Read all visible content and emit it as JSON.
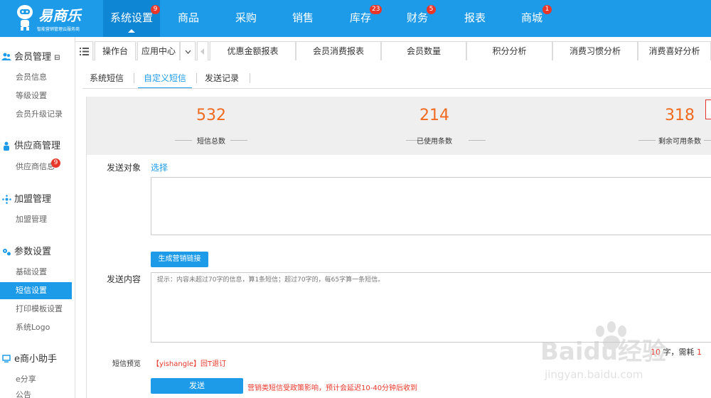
{
  "brand": {
    "name": "易商乐",
    "tagline": "智能营销管理云服务商"
  },
  "nav": [
    {
      "label": "系统设置",
      "badge": "9",
      "active": true
    },
    {
      "label": "商品",
      "badge": ""
    },
    {
      "label": "采购",
      "badge": ""
    },
    {
      "label": "销售",
      "badge": ""
    },
    {
      "label": "库存",
      "badge": "23"
    },
    {
      "label": "财务",
      "badge": "5"
    },
    {
      "label": "报表",
      "badge": ""
    },
    {
      "label": "商城",
      "badge": "1"
    }
  ],
  "sidebar": {
    "sections": [
      {
        "title": "会员管理",
        "toggle": "⊟",
        "icon": "users-icon",
        "items": [
          "会员信息",
          "等级设置",
          "会员升级记录"
        ]
      },
      {
        "title": "供应商管理",
        "icon": "supplier-icon",
        "items": [
          "供应商信息"
        ],
        "item_badge": "9"
      },
      {
        "title": "加盟管理",
        "icon": "network-icon",
        "items": [
          "加盟管理"
        ]
      },
      {
        "title": "参数设置",
        "icon": "gears-icon",
        "items": [
          "基础设置",
          "短信设置",
          "打印模板设置",
          "系统Logo"
        ],
        "active_item": "短信设置"
      },
      {
        "title": "e商小助手",
        "icon": "monitor-icon",
        "items": [
          "e分享",
          "公告"
        ]
      }
    ]
  },
  "tabs": {
    "home": "操作台",
    "app_center": "应用中心",
    "list": [
      "优惠金额报表",
      "会员消费报表",
      "会员数量",
      "积分分析",
      "消费习惯分析",
      "消费喜好分析"
    ]
  },
  "subtabs": [
    "系统短信",
    "自定义短信",
    "发送记录"
  ],
  "subtab_active": "自定义短信",
  "stats": [
    {
      "value": "532",
      "label": "短信总数"
    },
    {
      "value": "214",
      "label": "已使用条数"
    },
    {
      "value": "318",
      "label": "剩余可用条数"
    }
  ],
  "form": {
    "recipient_label": "发送对象",
    "select_link": "选择",
    "gen_link_button": "生成营销链接",
    "content_label": "发送内容",
    "content_hint": "提示：内容未超过70字的信息，算1条短信；超过70字的，每65字算一条短信。",
    "count_prefix": "",
    "count_value": "10",
    "count_suffix": "字，需耗",
    "count_tail": "1",
    "preview_label": "短信预览",
    "preview_text": "【yishangle】回T退订",
    "send_button": "发送",
    "notice": "营销类短信受政策影响，预计会延迟10-40分钟后收到"
  },
  "watermark": {
    "text": "Baidu经验",
    "url": "jingyan.baidu.com"
  },
  "colors": {
    "primary": "#1e9be8",
    "stat_number": "#f06a1f",
    "alert": "#e8372a"
  }
}
